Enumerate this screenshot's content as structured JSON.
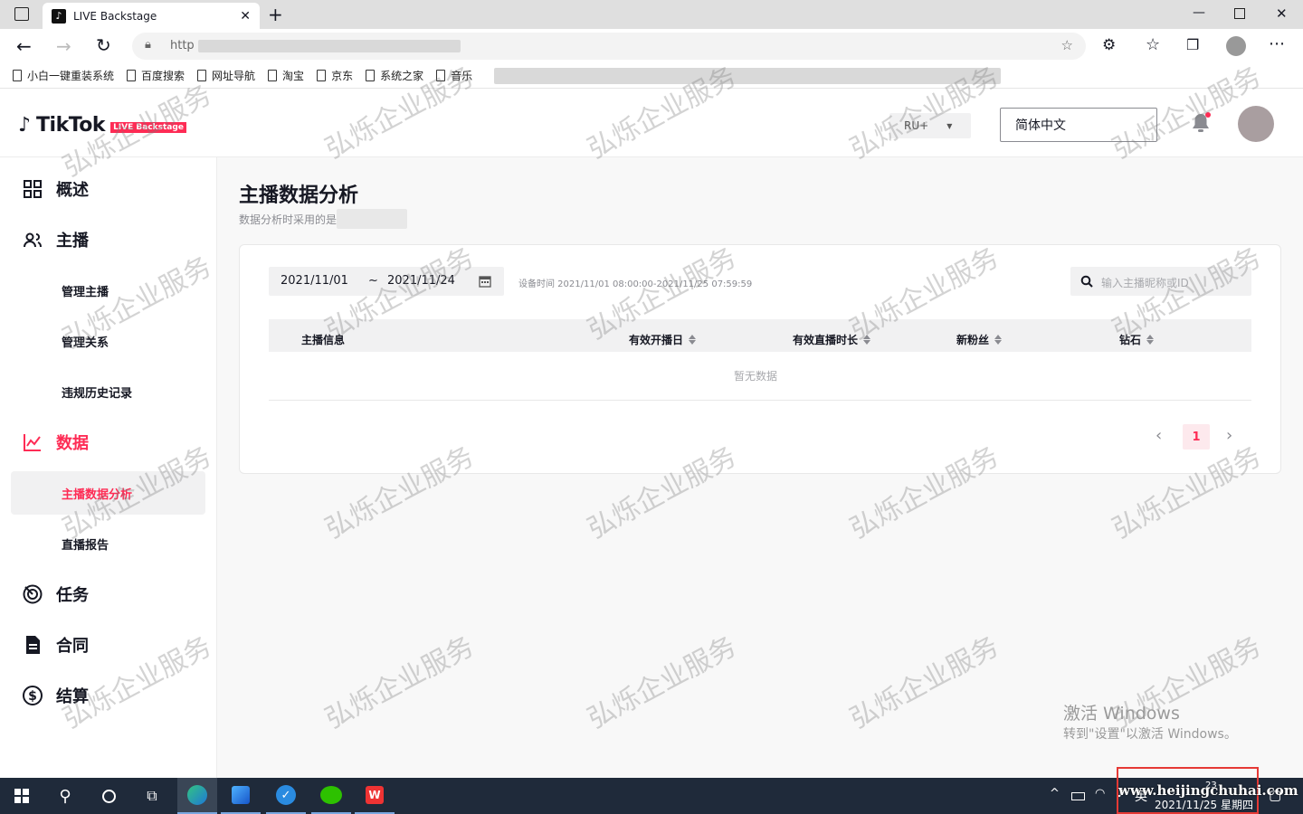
{
  "browser": {
    "tab_title": "LIVE Backstage",
    "url_prefix": "http",
    "bookmarks": [
      "小白一键重装系统",
      "百度搜索",
      "网址导航",
      "淘宝",
      "京东",
      "系统之家",
      "音乐"
    ]
  },
  "header": {
    "brand": "TikTok",
    "brand_badge": "LIVE Backstage",
    "region": "RU+",
    "language": "简体中文"
  },
  "sidebar": {
    "overview": "概述",
    "host": "主播",
    "manage_host": "管理主播",
    "manage_relation": "管理关系",
    "violation_history": "违规历史记录",
    "data": "数据",
    "host_data_analysis": "主播数据分析",
    "live_report": "直播报告",
    "task": "任务",
    "contract": "合同",
    "settlement": "结算"
  },
  "page": {
    "title": "主播数据分析",
    "subtitle": "数据分析时采用的是"
  },
  "filters": {
    "date_start": "2021/11/01",
    "date_sep": "~",
    "date_end": "2021/11/24",
    "device_time": "设备时间 2021/11/01 08:00:00-2021/11/25 07:59:59",
    "search_placeholder": "输入主播昵称或ID"
  },
  "table": {
    "columns": [
      "主播信息",
      "有效开播日",
      "有效直播时长",
      "新粉丝",
      "钻石"
    ],
    "empty": "暂无数据"
  },
  "pagination": {
    "current": "1"
  },
  "watermark": {
    "text": "弘烁企业服务",
    "activate_title": "激活 Windows",
    "activate_sub": "转到\"设置\"以激活 Windows。"
  },
  "taskbar": {
    "time": "23",
    "date": "2021/11/25 星期四",
    "ime": "英",
    "site": "www.heijingchuhai.com"
  },
  "colors": {
    "accent": "#fe2c55",
    "taskbar": "#1f2a3a"
  }
}
